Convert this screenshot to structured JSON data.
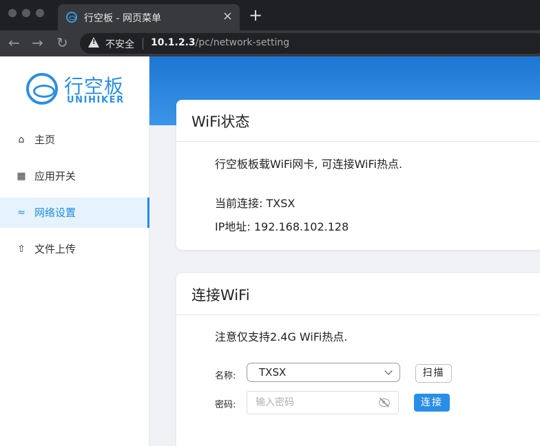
{
  "browser": {
    "tab_title": "行空板 - 网页菜单",
    "tab_close": "×",
    "new_tab": "+",
    "back_icon": "←",
    "forward_icon": "→",
    "reload_icon": "↻",
    "security_label": "不安全",
    "url_host": "10.1.2.3",
    "url_path": "/pc/network-setting"
  },
  "sidebar": {
    "logo_cn": "行空板",
    "logo_en": "UNIHIKER",
    "items": [
      {
        "label": "主页",
        "icon": "home-icon",
        "glyph": "⌂",
        "active": false
      },
      {
        "label": "应用开关",
        "icon": "grid-icon",
        "glyph": "▦",
        "active": false
      },
      {
        "label": "网络设置",
        "icon": "wifi-icon",
        "glyph": "≈",
        "active": true
      },
      {
        "label": "文件上传",
        "icon": "upload-icon",
        "glyph": "⇧",
        "active": false
      }
    ]
  },
  "wifi_status": {
    "title": "WiFi状态",
    "description": "行空板板载WiFi网卡, 可连接WiFi热点.",
    "current_connection": "当前连接: TXSX",
    "ip_address": "IP地址: 192.168.102.128"
  },
  "connect_wifi": {
    "title": "连接WiFi",
    "note": "注意仅支持2.4G WiFi热点.",
    "name_label": "名称:",
    "selected_ssid": "TXSX",
    "scan_label": "扫描",
    "password_label": "密码:",
    "password_placeholder": "输入密码",
    "connect_label": "连接"
  },
  "colors": {
    "accent": "#2a8ee6",
    "banner_top": "#1d76d4",
    "banner_bottom": "#3a96e8",
    "active_menu_bg": "#e6f3fd"
  }
}
